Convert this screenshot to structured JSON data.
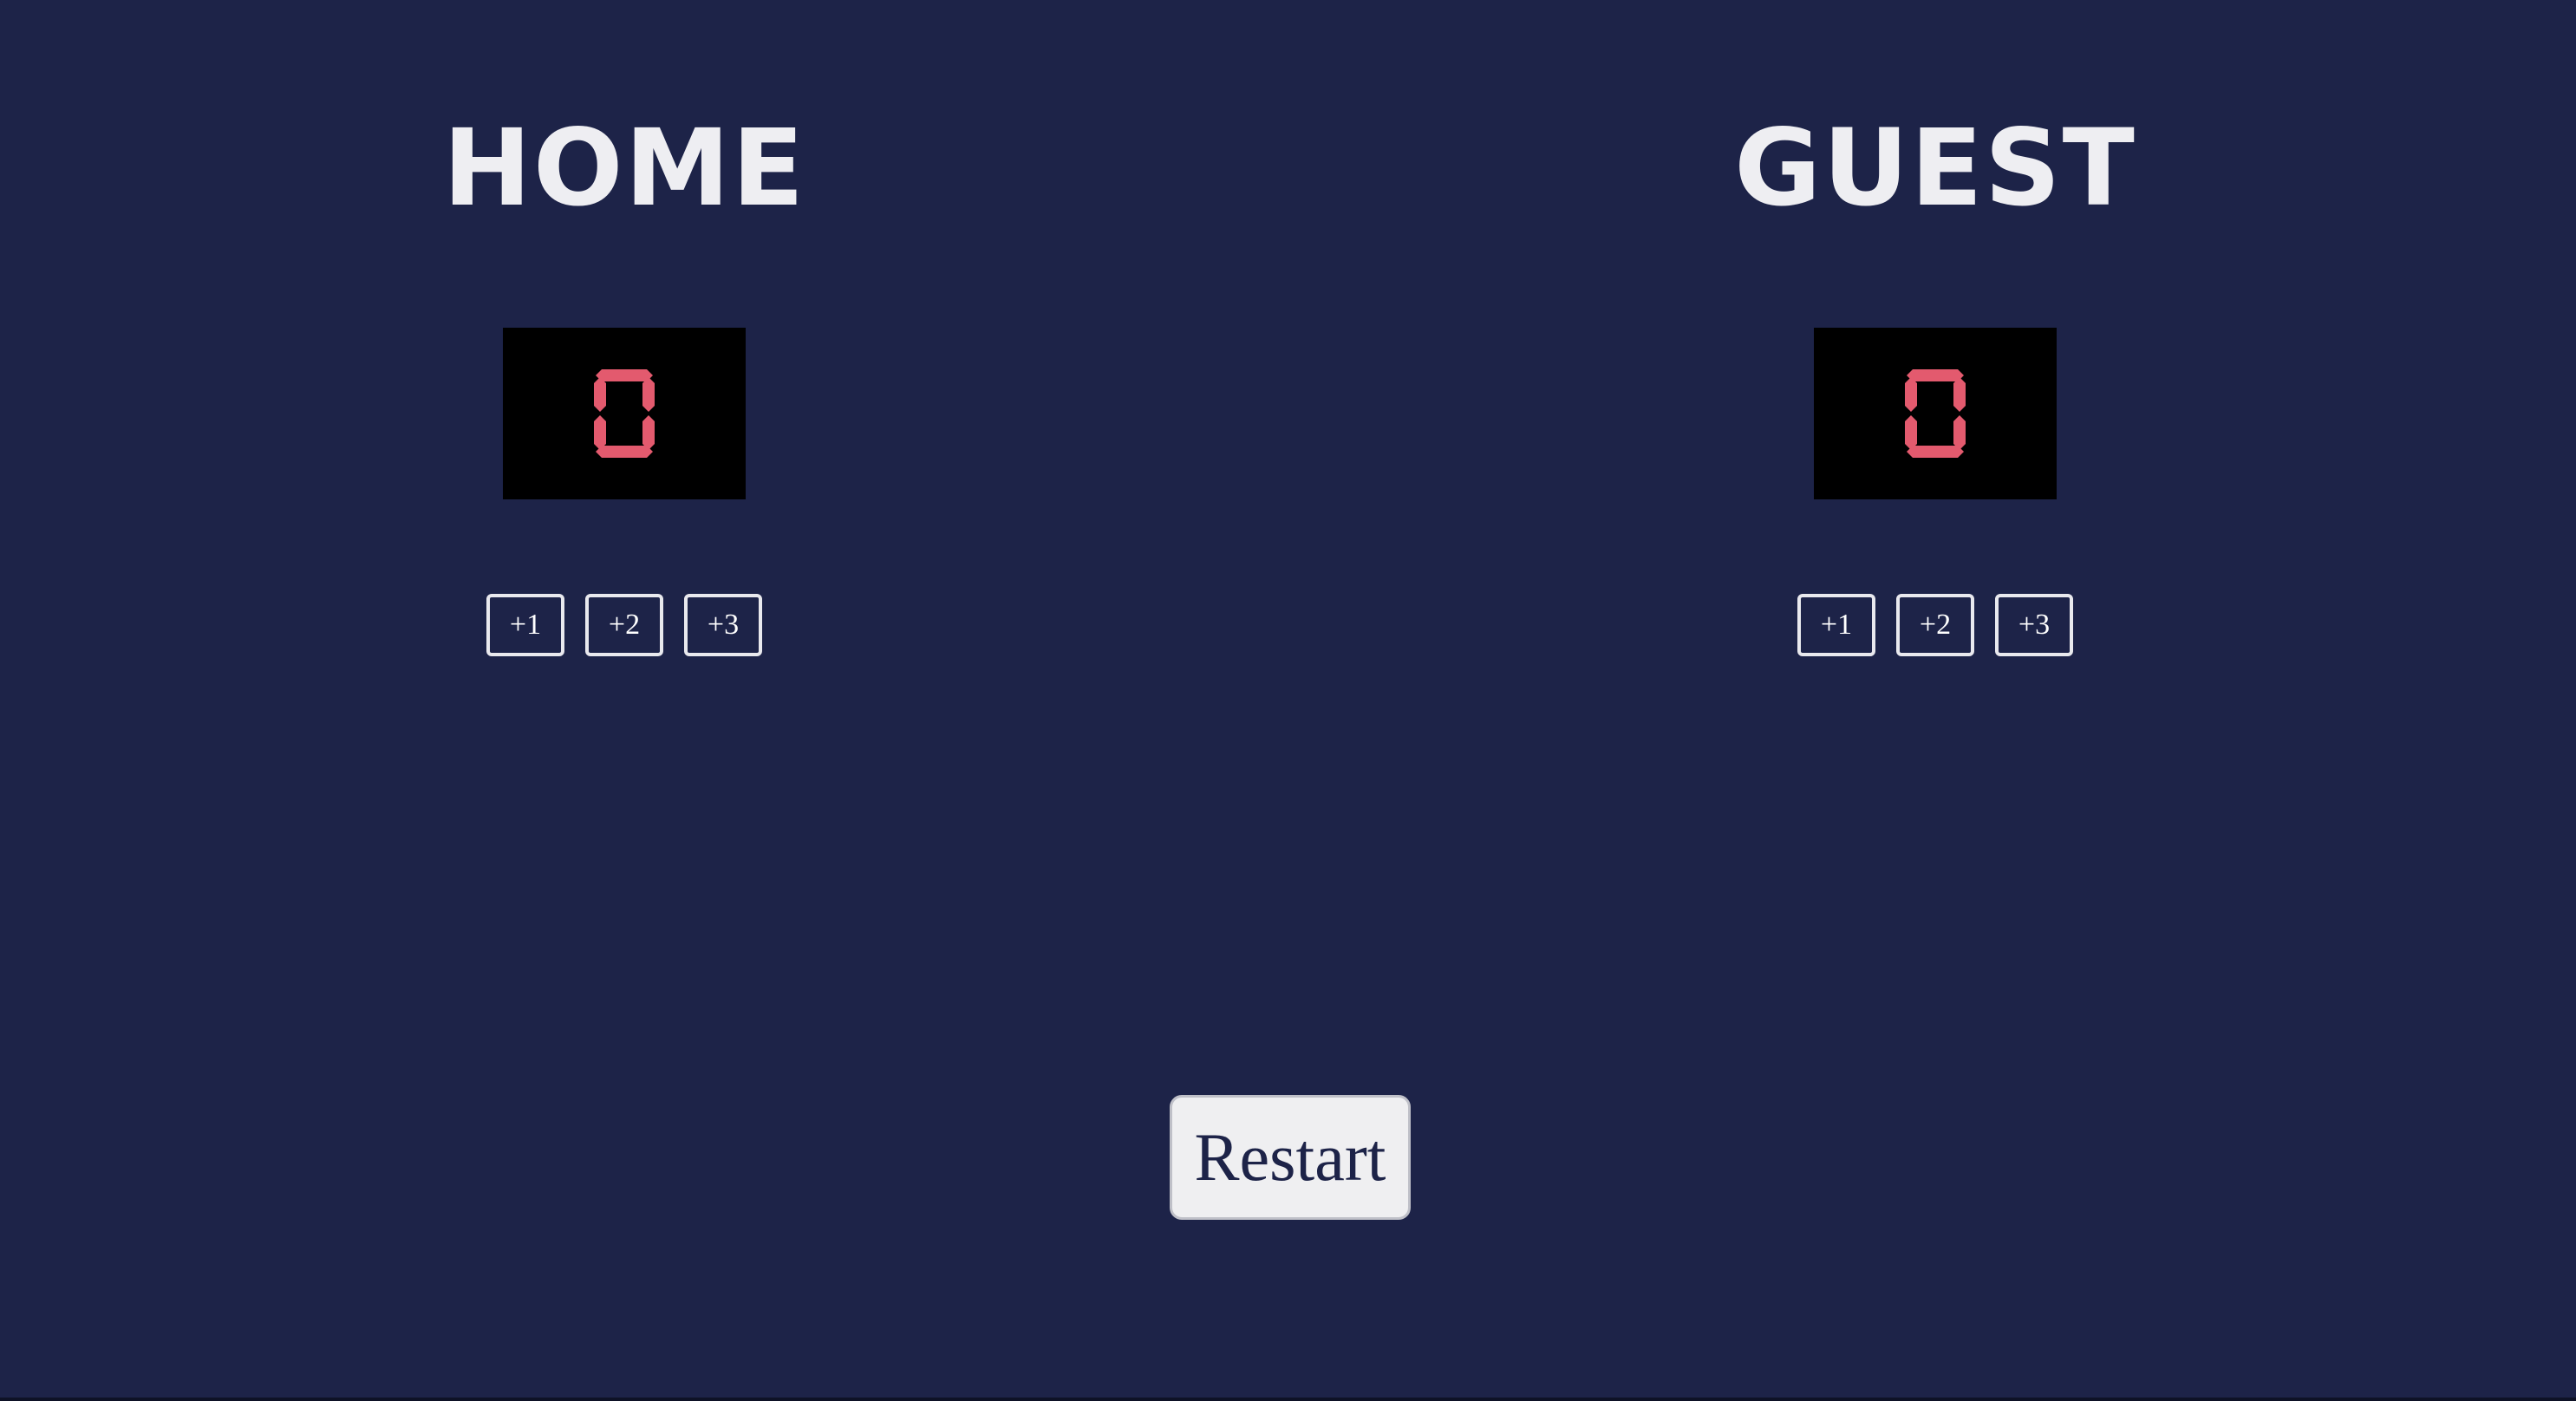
{
  "colors": {
    "background": "#1d2348",
    "score_digit": "#e35a6e",
    "score_box": "#000000",
    "title_text": "#eeeef2",
    "button_border": "#e9e9ee",
    "restart_bg": "#efeff1"
  },
  "home": {
    "title": "HOME",
    "score": "0",
    "buttons": [
      "+1",
      "+2",
      "+3"
    ]
  },
  "guest": {
    "title": "GUEST",
    "score": "0",
    "buttons": [
      "+1",
      "+2",
      "+3"
    ]
  },
  "restart_label": "Restart"
}
